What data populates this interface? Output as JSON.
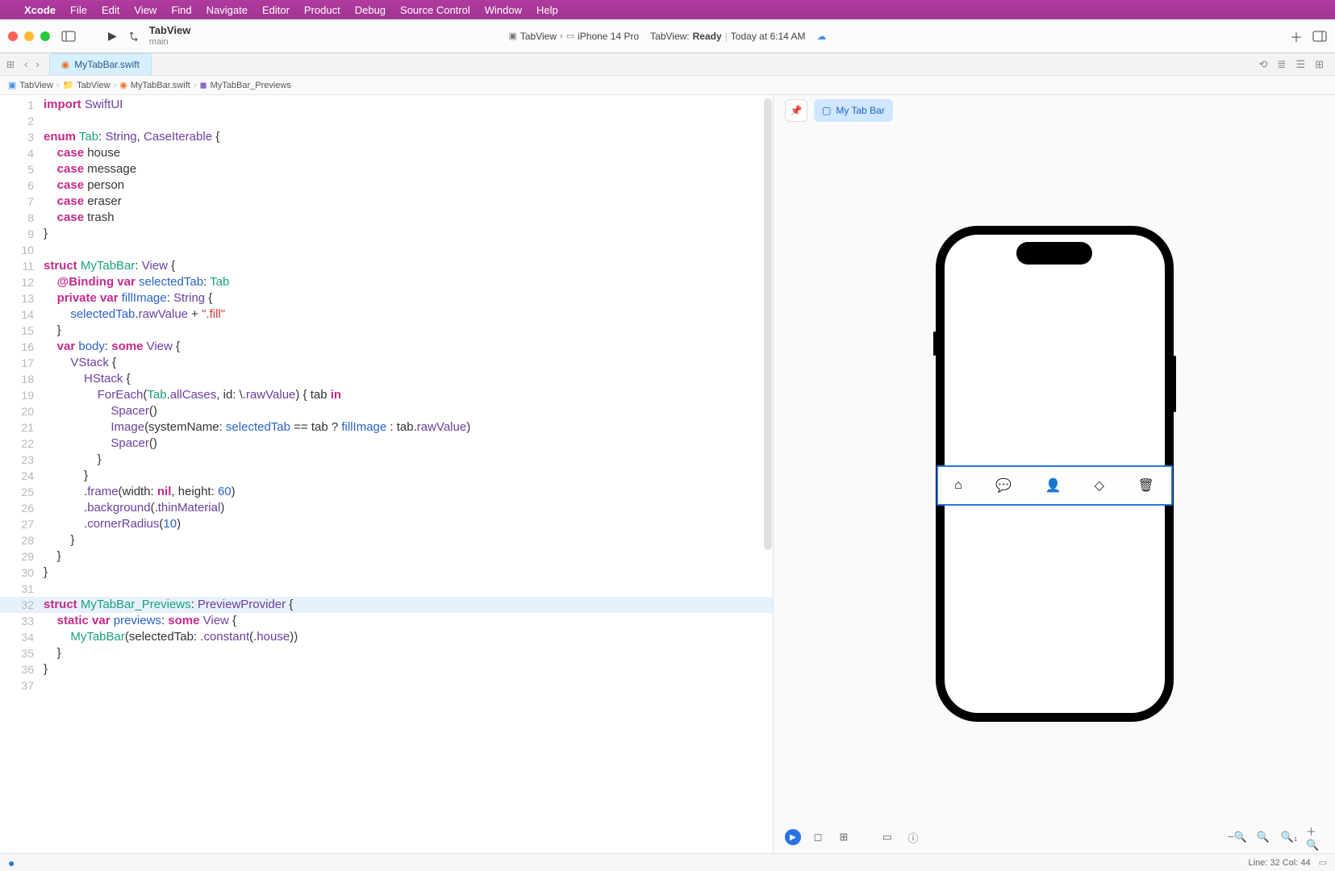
{
  "menubar": {
    "app": "Xcode",
    "items": [
      "File",
      "Edit",
      "View",
      "Find",
      "Navigate",
      "Editor",
      "Product",
      "Debug",
      "Source Control",
      "Window",
      "Help"
    ]
  },
  "titlebar": {
    "project_name": "TabView",
    "branch": "main",
    "scheme": "TabView",
    "device": "iPhone 14 Pro",
    "status_app": "TabView:",
    "status_state": "Ready",
    "status_time": "Today at 6:14 AM"
  },
  "tabrow": {
    "file": "MyTabBar.swift"
  },
  "jumpbar": {
    "items": [
      "TabView",
      "TabView",
      "MyTabBar.swift",
      "MyTabBar_Previews"
    ]
  },
  "code_lines": [
    {
      "n": 1,
      "html": "<span class='kw-pink'>import</span> <span class='kw-purple'>SwiftUI</span>"
    },
    {
      "n": 2,
      "html": ""
    },
    {
      "n": 3,
      "html": "<span class='kw-pink'>enum</span> <span class='kw-teal'>Tab</span>: <span class='kw-purple'>String</span>, <span class='kw-purple'>CaseIterable</span> {"
    },
    {
      "n": 4,
      "html": "    <span class='kw-pink'>case</span> house"
    },
    {
      "n": 5,
      "html": "    <span class='kw-pink'>case</span> message"
    },
    {
      "n": 6,
      "html": "    <span class='kw-pink'>case</span> person"
    },
    {
      "n": 7,
      "html": "    <span class='kw-pink'>case</span> eraser"
    },
    {
      "n": 8,
      "html": "    <span class='kw-pink'>case</span> trash"
    },
    {
      "n": 9,
      "html": "}"
    },
    {
      "n": 10,
      "html": ""
    },
    {
      "n": 11,
      "html": "<span class='kw-pink'>struct</span> <span class='kw-teal'>MyTabBar</span>: <span class='kw-purple'>View</span> {"
    },
    {
      "n": 12,
      "html": "    <span class='kw-pink'>@Binding</span> <span class='kw-pink'>var</span> <span class='kw-blue'>selectedTab</span>: <span class='kw-teal'>Tab</span>"
    },
    {
      "n": 13,
      "html": "    <span class='kw-pink'>private</span> <span class='kw-pink'>var</span> <span class='kw-blue'>fillImage</span>: <span class='kw-purple'>String</span> {"
    },
    {
      "n": 14,
      "html": "        <span class='kw-blue'>selectedTab</span>.<span class='kw-purple'>rawValue</span> + <span class='str'>\".fill\"</span>"
    },
    {
      "n": 15,
      "html": "    }"
    },
    {
      "n": 16,
      "html": "    <span class='kw-pink'>var</span> <span class='kw-blue'>body</span>: <span class='kw-pink'>some</span> <span class='kw-purple'>View</span> {"
    },
    {
      "n": 17,
      "html": "        <span class='kw-purple'>VStack</span> {"
    },
    {
      "n": 18,
      "html": "            <span class='kw-purple'>HStack</span> {"
    },
    {
      "n": 19,
      "html": "                <span class='kw-purple'>ForEach</span>(<span class='kw-teal'>Tab</span>.<span class='kw-purple'>allCases</span>, id: \\.<span class='kw-purple'>rawValue</span>) { tab <span class='kw-pink'>in</span>"
    },
    {
      "n": 20,
      "html": "                    <span class='kw-purple'>Spacer</span>()"
    },
    {
      "n": 21,
      "html": "                    <span class='kw-purple'>Image</span>(systemName: <span class='kw-blue'>selectedTab</span> == tab ? <span class='kw-blue'>fillImage</span> : tab.<span class='kw-purple'>rawValue</span>)"
    },
    {
      "n": 22,
      "html": "                    <span class='kw-purple'>Spacer</span>()"
    },
    {
      "n": 23,
      "html": "                }"
    },
    {
      "n": 24,
      "html": "            }"
    },
    {
      "n": 25,
      "html": "            .<span class='kw-purple'>frame</span>(width: <span class='kw-pink'>nil</span>, height: <span class='kw-blue'>60</span>)"
    },
    {
      "n": 26,
      "html": "            .<span class='kw-purple'>background</span>(.<span class='kw-purple'>thinMaterial</span>)"
    },
    {
      "n": 27,
      "html": "            .<span class='kw-purple'>cornerRadius</span>(<span class='kw-blue'>10</span>)"
    },
    {
      "n": 28,
      "html": "        }"
    },
    {
      "n": 29,
      "html": "    }"
    },
    {
      "n": 30,
      "html": "}"
    },
    {
      "n": 31,
      "html": ""
    },
    {
      "n": 32,
      "html": "<span class='kw-pink'>struct</span> <span class='kw-teal'>MyTabBar_Previews</span>: <span class='kw-purple'>PreviewProvider</span> {",
      "hl": true
    },
    {
      "n": 33,
      "html": "    <span class='kw-pink'>static</span> <span class='kw-pink'>var</span> <span class='kw-blue'>previews</span>: <span class='kw-pink'>some</span> <span class='kw-purple'>View</span> {"
    },
    {
      "n": 34,
      "html": "        <span class='kw-teal'>MyTabBar</span>(selectedTab: .<span class='kw-purple'>constant</span>(.<span class='kw-purple'>house</span>))"
    },
    {
      "n": 35,
      "html": "    }"
    },
    {
      "n": 36,
      "html": "}"
    },
    {
      "n": 37,
      "html": ""
    }
  ],
  "preview": {
    "chip_label": "My Tab Bar"
  },
  "statusbar": {
    "cursor": "Line: 32   Col: 44"
  }
}
